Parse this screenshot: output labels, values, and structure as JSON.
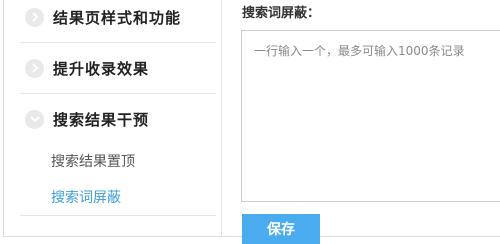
{
  "sidebar": {
    "sections": [
      {
        "label": "结果页样式和功能",
        "icon": "chevron-right-icon",
        "expanded": false
      },
      {
        "label": "提升收录效果",
        "icon": "chevron-right-icon",
        "expanded": false
      },
      {
        "label": "搜索结果干预",
        "icon": "chevron-down-icon",
        "expanded": true,
        "items": [
          {
            "label": "搜索结果置顶",
            "active": false
          },
          {
            "label": "搜索词屏蔽",
            "active": true
          }
        ]
      }
    ]
  },
  "main": {
    "field_label": "搜索词屏蔽：",
    "textarea_placeholder": "一行输入一个，最多可输入1000条记录",
    "textarea_value": "",
    "save_label": "保存"
  },
  "colors": {
    "accent": "#4aacee",
    "active_link": "#3a9fd8",
    "chevron_bg": "#e9e9e9"
  }
}
